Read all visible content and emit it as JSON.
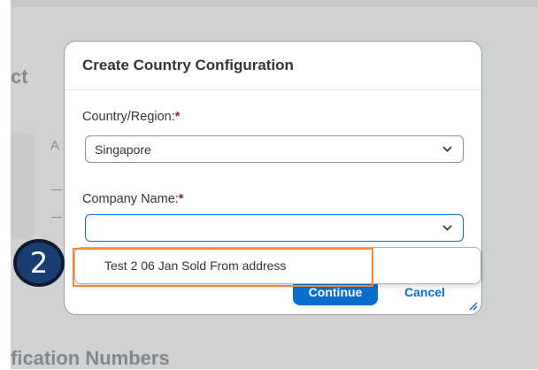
{
  "background": {
    "section_title_partial": "ct",
    "label_partial": "A",
    "bottom_section_partial": "fication Numbers"
  },
  "dialog": {
    "title": "Create Country Configuration",
    "country": {
      "label": "Country/Region:",
      "required_mark": "*",
      "value": "Singapore"
    },
    "company": {
      "label": "Company Name:",
      "required_mark": "*",
      "value": ""
    },
    "buttons": {
      "continue_label": "Continue",
      "cancel_label": "Cancel"
    }
  },
  "dropdown": {
    "options": [
      "Test 2 06 Jan Sold From address"
    ]
  },
  "annotation": {
    "step_number": "2",
    "highlight_color": "#ef8a3a",
    "badge_color": "#1a3e72"
  },
  "colors": {
    "accent": "#0a6ed1",
    "required": "#a5134d"
  }
}
